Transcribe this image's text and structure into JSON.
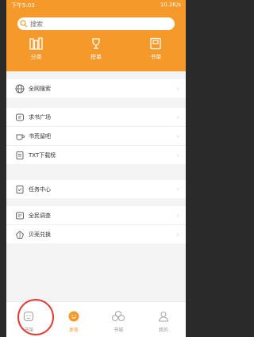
{
  "statusbar": {
    "time": "下午5:03",
    "network": "10.2K/s"
  },
  "search": {
    "placeholder": "搜索"
  },
  "quick": [
    {
      "label": "分类",
      "icon": "bookshelf-icon"
    },
    {
      "label": "榜单",
      "icon": "trophy-icon"
    },
    {
      "label": "书单",
      "icon": "booklist-icon"
    }
  ],
  "sections": [
    {
      "items": [
        {
          "label": "全网搜索",
          "icon": "globe-icon"
        }
      ]
    },
    {
      "items": [
        {
          "label": "求书广场",
          "icon": "square-icon"
        },
        {
          "label": "书荒留吧",
          "icon": "coffee-icon"
        },
        {
          "label": "TXT下载榜",
          "icon": "download-icon"
        }
      ]
    },
    {
      "items": [
        {
          "label": "任务中心",
          "icon": "task-icon"
        }
      ]
    },
    {
      "items": [
        {
          "label": "全民调查",
          "icon": "survey-icon"
        },
        {
          "label": "贝壳兑换",
          "icon": "shell-icon"
        }
      ]
    }
  ],
  "nav": [
    {
      "label": "书架",
      "icon": "bookshelf-tab-icon"
    },
    {
      "label": "发现",
      "icon": "discover-icon"
    },
    {
      "label": "书城",
      "icon": "bookstore-icon"
    },
    {
      "label": "我的",
      "icon": "profile-icon"
    }
  ],
  "colors": {
    "brand": "#f59a2a",
    "highlight": "#e53935"
  }
}
